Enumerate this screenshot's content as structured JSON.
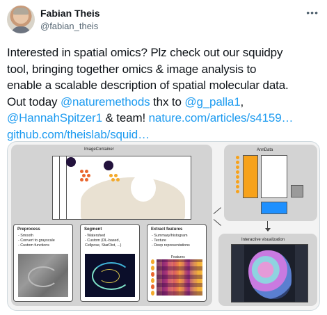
{
  "author": {
    "name": "Fabian Theis",
    "handle": "@fabian_theis",
    "more_icon": "more-horizontal-icon"
  },
  "tweet": {
    "line1": "Interested in spatial omics? Plz check out our squidpy",
    "line2": "tool, bringing together omics & image analysis to",
    "line3": "enable a scalable description of spatial molecular data.",
    "line4_pre": "Out today ",
    "mention_naturemethods": "@naturemethods",
    "line4_mid": " thx to ",
    "mention_palla": "@g_palla1",
    "line4_post": ",",
    "mention_spitzer": "@HannahSpitzer1",
    "line5_mid": " & team! ",
    "link_nature": "nature.com/articles/s4159…",
    "link_github": "github.com/theislab/squid…"
  },
  "figure": {
    "image_container": "ImageContainer",
    "anndata": "AnnData",
    "interactive": "Interactive visualization",
    "preprocess": {
      "title": "Preprocess",
      "items": [
        "- Smooth",
        "- Convert to grayscale",
        "- Custom functions"
      ]
    },
    "segment": {
      "title": "Segment",
      "items": [
        "- Watershed",
        "- Custom (DL-based,",
        "  Cellpose, StarDist, ...)"
      ]
    },
    "extract": {
      "title": "Extract features",
      "items": [
        "- Summary/histogram",
        "- Texture",
        "- Deep representations"
      ]
    },
    "features_label": "Features",
    "colors": {
      "panel": "#d3d3d3",
      "orange": "#f7a21b",
      "blue": "#1e90ff",
      "grey": "#9a9a9a"
    }
  }
}
